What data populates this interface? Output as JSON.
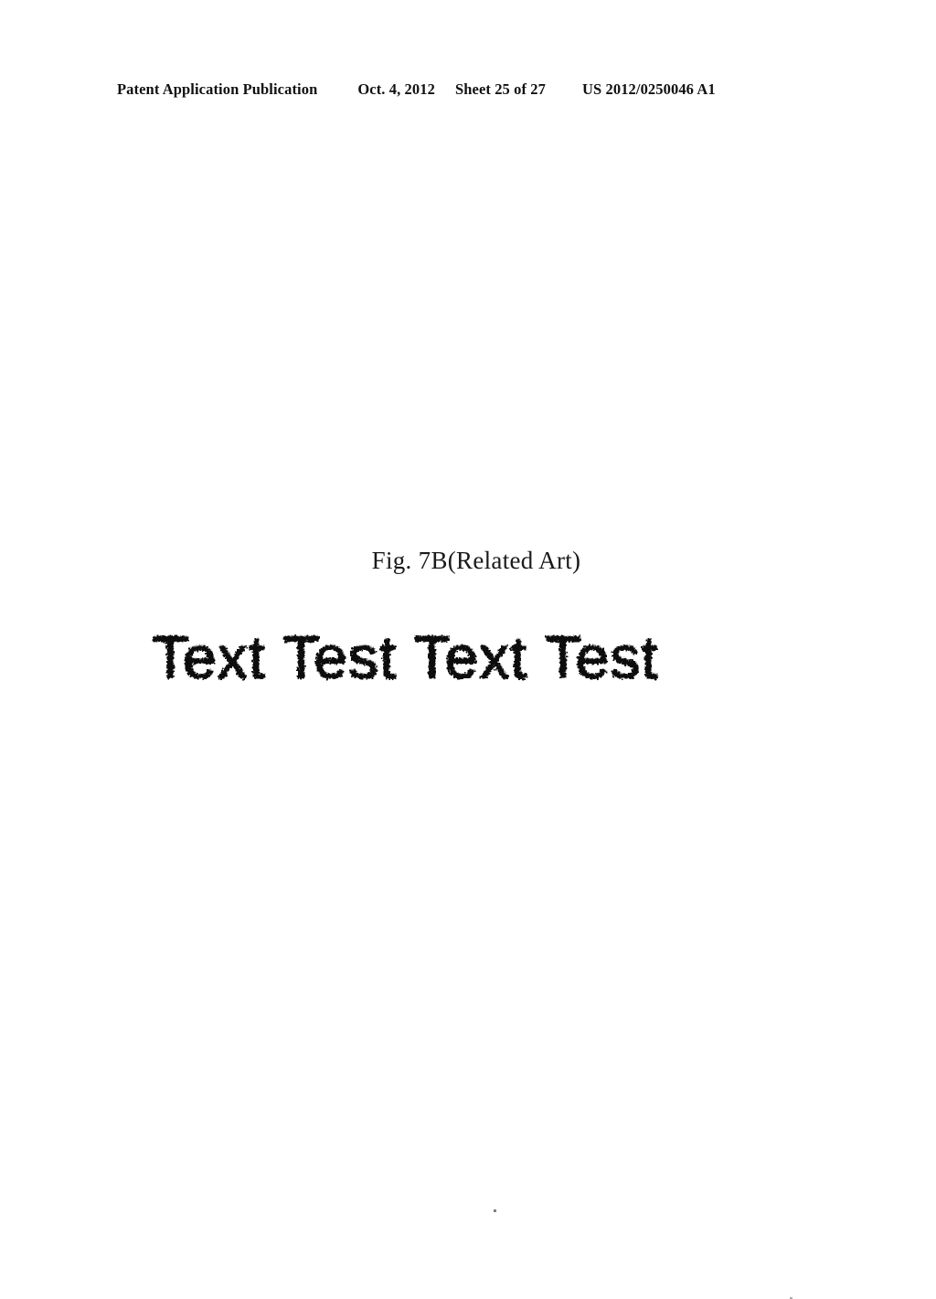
{
  "header": {
    "publication_label": "Patent Application Publication",
    "date": "Oct. 4, 2012",
    "sheet": "Sheet 25 of 27",
    "document_number": "US 2012/0250046 A1"
  },
  "figure": {
    "caption": "Fig. 7B(Related Art)",
    "sample_text": "Text Test Text Test",
    "sample_text_appearance": "degraded dithered halftone rendering of the sample string",
    "ink_color": "#0d0d0d",
    "page_background": "#ffffff"
  },
  "artifacts": {
    "speck_upper": "ink-speck",
    "speck_lower": "ink-speck"
  }
}
